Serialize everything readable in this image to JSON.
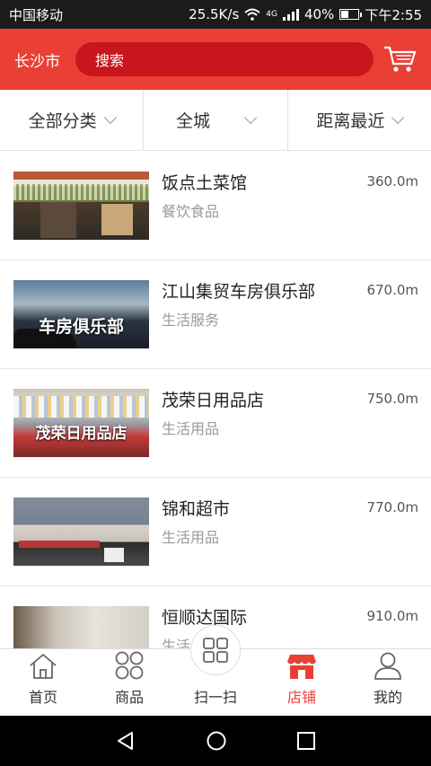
{
  "status": {
    "carrier": "中国移动",
    "speed": "25.5K/s",
    "network": "4G",
    "battery": "40%",
    "battery_level": 0.4,
    "time": "下午2:55"
  },
  "header": {
    "city": "长沙市",
    "search_placeholder": "搜索"
  },
  "filters": [
    {
      "label": "全部分类"
    },
    {
      "label": "全城"
    },
    {
      "label": "距离最近"
    }
  ],
  "stores": [
    {
      "name": "饭点土菜馆",
      "category": "餐饮食品",
      "distance": "360.0m",
      "caption": ""
    },
    {
      "name": "江山集贸车房俱乐部",
      "category": "生活服务",
      "distance": "670.0m",
      "caption": "车房俱乐部"
    },
    {
      "name": "茂荣日用品店",
      "category": "生活用品",
      "distance": "750.0m",
      "caption": "茂荣日用品店"
    },
    {
      "name": "锦和超市",
      "category": "生活用品",
      "distance": "770.0m",
      "caption": ""
    },
    {
      "name": "恒顺达国际",
      "category": "生活",
      "distance": "910.0m",
      "caption": ""
    }
  ],
  "nav": [
    {
      "label": "首页",
      "icon": "home-icon"
    },
    {
      "label": "商品",
      "icon": "grid-icon"
    },
    {
      "label": "扫一扫",
      "icon": "scan-icon"
    },
    {
      "label": "店铺",
      "icon": "store-icon",
      "active": true
    },
    {
      "label": "我的",
      "icon": "user-icon"
    }
  ],
  "colors": {
    "brand": "#ea3f35",
    "search_bg": "#c9161c"
  }
}
